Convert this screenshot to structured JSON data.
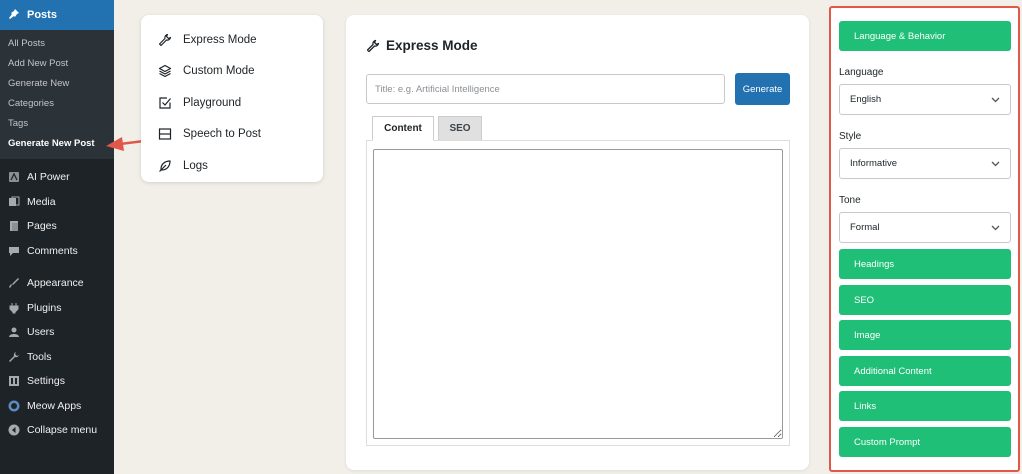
{
  "sidebar": {
    "active": {
      "label": "Posts",
      "icon": "pin-icon"
    },
    "submenu": [
      "All Posts",
      "Add New Post",
      "Generate New",
      "Categories",
      "Tags",
      "Generate New Post"
    ],
    "items": [
      {
        "label": "AI Power",
        "icon": "ai-power-icon"
      },
      {
        "label": "Media",
        "icon": "media-icon"
      },
      {
        "label": "Pages",
        "icon": "pages-icon"
      },
      {
        "label": "Comments",
        "icon": "comments-icon"
      },
      {
        "label": "Appearance",
        "icon": "appearance-icon"
      },
      {
        "label": "Plugins",
        "icon": "plugins-icon"
      },
      {
        "label": "Users",
        "icon": "users-icon"
      },
      {
        "label": "Tools",
        "icon": "tools-icon"
      },
      {
        "label": "Settings",
        "icon": "settings-icon"
      },
      {
        "label": "Meow Apps",
        "icon": "meow-apps-icon"
      },
      {
        "label": "Collapse menu",
        "icon": "collapse-icon"
      }
    ]
  },
  "modes": [
    {
      "label": "Express Mode",
      "icon": "wrench-icon"
    },
    {
      "label": "Custom Mode",
      "icon": "layers-icon"
    },
    {
      "label": "Playground",
      "icon": "checkbox-icon"
    },
    {
      "label": "Speech to Post",
      "icon": "speech-box-icon"
    },
    {
      "label": "Logs",
      "icon": "feather-icon"
    }
  ],
  "main": {
    "title": "Express Mode",
    "input_placeholder": "Title: e.g. Artificial Intelligence",
    "generate_label": "Generate",
    "tabs": [
      "Content",
      "SEO"
    ]
  },
  "settings": {
    "language_behavior": "Language & Behavior",
    "language_label": "Language",
    "language_value": "English",
    "style_label": "Style",
    "style_value": "Informative",
    "tone_label": "Tone",
    "tone_value": "Formal",
    "sections": [
      "Headings",
      "SEO",
      "Image",
      "Additional Content",
      "Links",
      "Custom Prompt"
    ]
  },
  "colors": {
    "sidebar_bg": "#1d2327",
    "active_blue": "#2271b1",
    "green": "#1fbf77",
    "highlight_red": "#e0584a"
  }
}
